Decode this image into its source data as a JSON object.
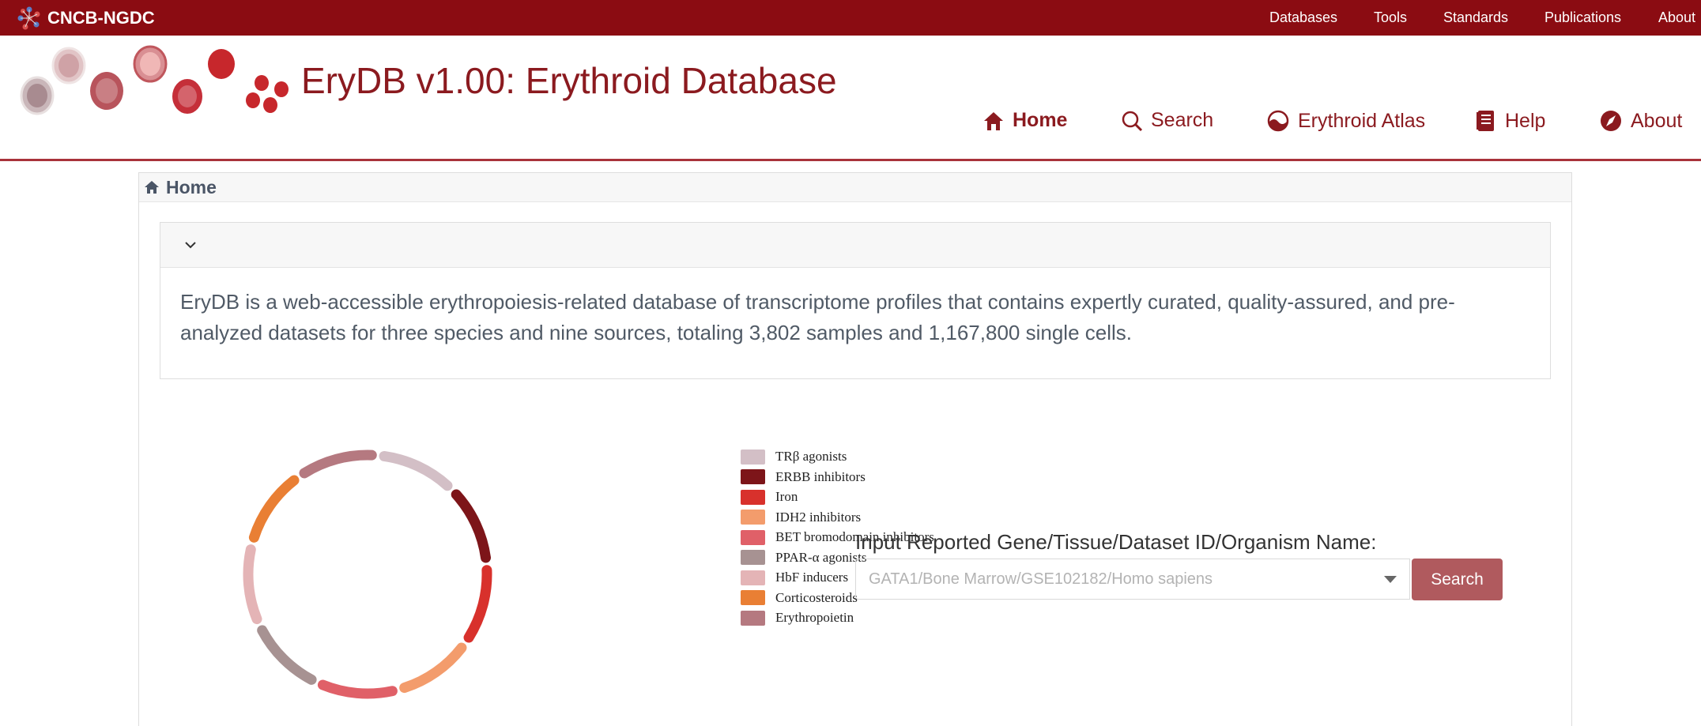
{
  "topbar": {
    "brand": "CNCB-NGDC",
    "links": [
      "Databases",
      "Tools",
      "Standards",
      "Publications",
      "About"
    ]
  },
  "header": {
    "title": "EryDB v1.00: Erythroid Database",
    "nav": [
      {
        "label": "Home",
        "icon": "home-icon",
        "active": true
      },
      {
        "label": "Search",
        "icon": "search-icon"
      },
      {
        "label": "Erythroid Atlas",
        "icon": "atlas-icon"
      },
      {
        "label": "Help",
        "icon": "book-icon"
      },
      {
        "label": "About",
        "icon": "compass-icon"
      }
    ]
  },
  "breadcrumb": {
    "label": "Home"
  },
  "intro": {
    "text": "EryDB is a web-accessible erythropoiesis-related database of transcriptome profiles that contains expertly curated, quality-assured, and pre-analyzed datasets for three species and nine sources, totaling 3,802 samples and 1,167,800 single cells."
  },
  "chart_data": {
    "type": "pie",
    "categories": [
      "TRβ agonists",
      "ERBB inhibitors",
      "Iron",
      "IDH2 inhibitors",
      "BET bromodomain inhibitors",
      "PPAR-α agonists",
      "HbF inducers",
      "Corticosteroids",
      "Erythropoietin"
    ],
    "values": [
      1,
      1,
      1,
      1,
      1,
      1,
      1,
      1,
      1
    ],
    "colors": [
      "#d3bfc6",
      "#7d1519",
      "#d8312c",
      "#f39c6c",
      "#e06068",
      "#a79292",
      "#e4b4b6",
      "#e97f34",
      "#b57980"
    ],
    "legend_position": "right",
    "style": "donut"
  },
  "search": {
    "label": "Input Reported Gene/Tissue/Dataset ID/Organism Name:",
    "placeholder": "GATA1/Bone Marrow/GSE102182/Homo sapiens",
    "value": "",
    "button": "Search"
  },
  "colors": {
    "brand": "#8b0c12",
    "title": "#8b1a1f",
    "button": "#b05a5e"
  }
}
